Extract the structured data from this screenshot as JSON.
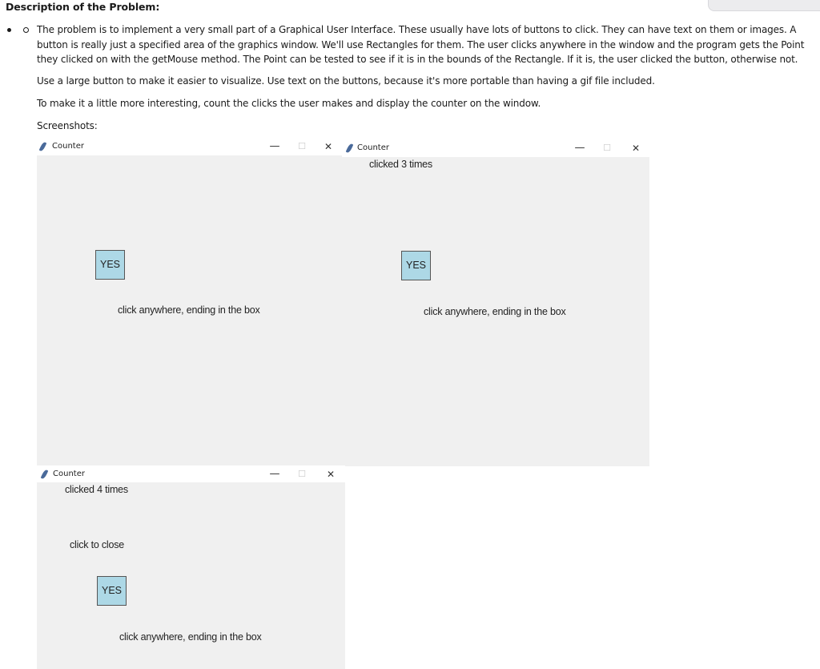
{
  "document": {
    "heading": "Description of the Problem:",
    "paragraphs": [
      "The problem is to implement a very small part of a Graphical User Interface. These usually have lots of buttons to click. They can have text on them or images. A button is really just a specified area of the graphics window. We'll use Rectangles for them. The user clicks anywhere in the window and the program gets the Point they clicked on with the getMouse method. The Point can be tested to see if it is in the bounds of the Rectangle. If it is, the user clicked the button, otherwise not.",
      "Use a large button to make it easier to visualize. Use text on the buttons, because it's more portable than having a gif file included.",
      "To make it a little more interesting, count the clicks the user makes and display the counter on the window.",
      "Screenshots:"
    ]
  },
  "screenshots": [
    {
      "title": "Counter",
      "icon": "feather-icon",
      "controls": {
        "minimize": "—",
        "maximize": "☐",
        "close": "✕"
      },
      "counter_text": "",
      "button_label": "YES",
      "instruction": "click anywhere, ending in the box"
    },
    {
      "title": "Counter",
      "icon": "feather-icon",
      "controls": {
        "minimize": "—",
        "maximize": "☐",
        "close": "✕"
      },
      "counter_text": "clicked 3 times",
      "button_label": "YES",
      "instruction": "click anywhere, ending in the box"
    },
    {
      "title": "Counter",
      "icon": "feather-icon",
      "controls": {
        "minimize": "—",
        "maximize": "☐",
        "close": "✕"
      },
      "counter_text": "clicked 4 times",
      "close_prompt": "click to close",
      "button_label": "YES",
      "instruction": "click anywhere, ending in the box"
    }
  ],
  "colors": {
    "canvas_bg": "#f0f0f0",
    "button_fill": "#add8e6",
    "button_border": "#555555"
  }
}
